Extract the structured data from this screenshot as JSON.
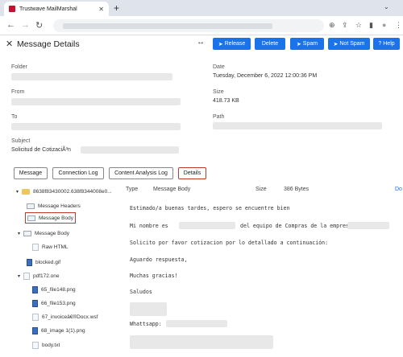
{
  "browser": {
    "tab_title": "Trustwave MailMarshal",
    "tab_close": "✕",
    "new_tab": "+",
    "tabbar_chevron": "⌄",
    "nav": {
      "back": "←",
      "forward": "→",
      "reload": "↻"
    },
    "toolbar_icons": {
      "zoom": "⊕",
      "share": "⇪",
      "star": "☆",
      "sidebar": "▮",
      "profile": "●",
      "menu": "⋮"
    }
  },
  "header": {
    "close": "✕",
    "title": "Message Details",
    "more": "↔",
    "buttons": {
      "release": "Release",
      "delete": "Delete",
      "spam": "Spam",
      "not_spam": "Not Spam",
      "help": "Help"
    },
    "button_icons": {
      "release": "➤",
      "spam": "➤",
      "not_spam": "➤",
      "help": "?"
    }
  },
  "properties": {
    "folder_label": "Folder",
    "date_label": "Date",
    "date_value": "Tuesday, December 6, 2022 12:00:36 PM",
    "from_label": "From",
    "size_label": "Size",
    "size_value": "418.73 KB",
    "to_label": "To",
    "path_label": "Path",
    "subject_label": "Subject",
    "subject_value": "Solicitud de CotizaciÃ³n"
  },
  "tabs": {
    "message": "Message",
    "connection_log": "Connection Log",
    "content_analysis_log": "Content Analysis Log",
    "details": "Details"
  },
  "tree": {
    "root": "8638f83430002.638f8344008e0...",
    "message_headers": "Message Headers",
    "message_body": "Message Body",
    "message_body_group": "Message Body",
    "raw_html": "Raw HTML",
    "blocked_gif": "blocked.gif",
    "pdf_one": "pdf172.one",
    "file_65": "65_file148.png",
    "file_66": "66_file153.png",
    "file_67": "67_invoiceâ€®Docx.wsf",
    "file_68": "68_image 1(1).png",
    "body_txt": "body.txt"
  },
  "content": {
    "type_label": "Type",
    "type_value": "Message Body",
    "size_label": "Size",
    "size_value": "386 Bytes",
    "download": "Do",
    "body": {
      "line1": "Estimado/a buenas tardes, espero se encuentre bien",
      "line2a": "Mi nombre es",
      "line2b": "del equipo de Compras de la empresa",
      "line3": "Solicito por favor cotizacion por lo detallado a continuación:",
      "line4": "Aguardo respuesta,",
      "line5": "Muchas gracias!",
      "line6": "Saludos",
      "whatsapp": "Whattsapp:"
    }
  },
  "colors": {
    "accent": "#1a73e8",
    "selected_outline": "#c0392b",
    "folder": "#f0c75e"
  }
}
